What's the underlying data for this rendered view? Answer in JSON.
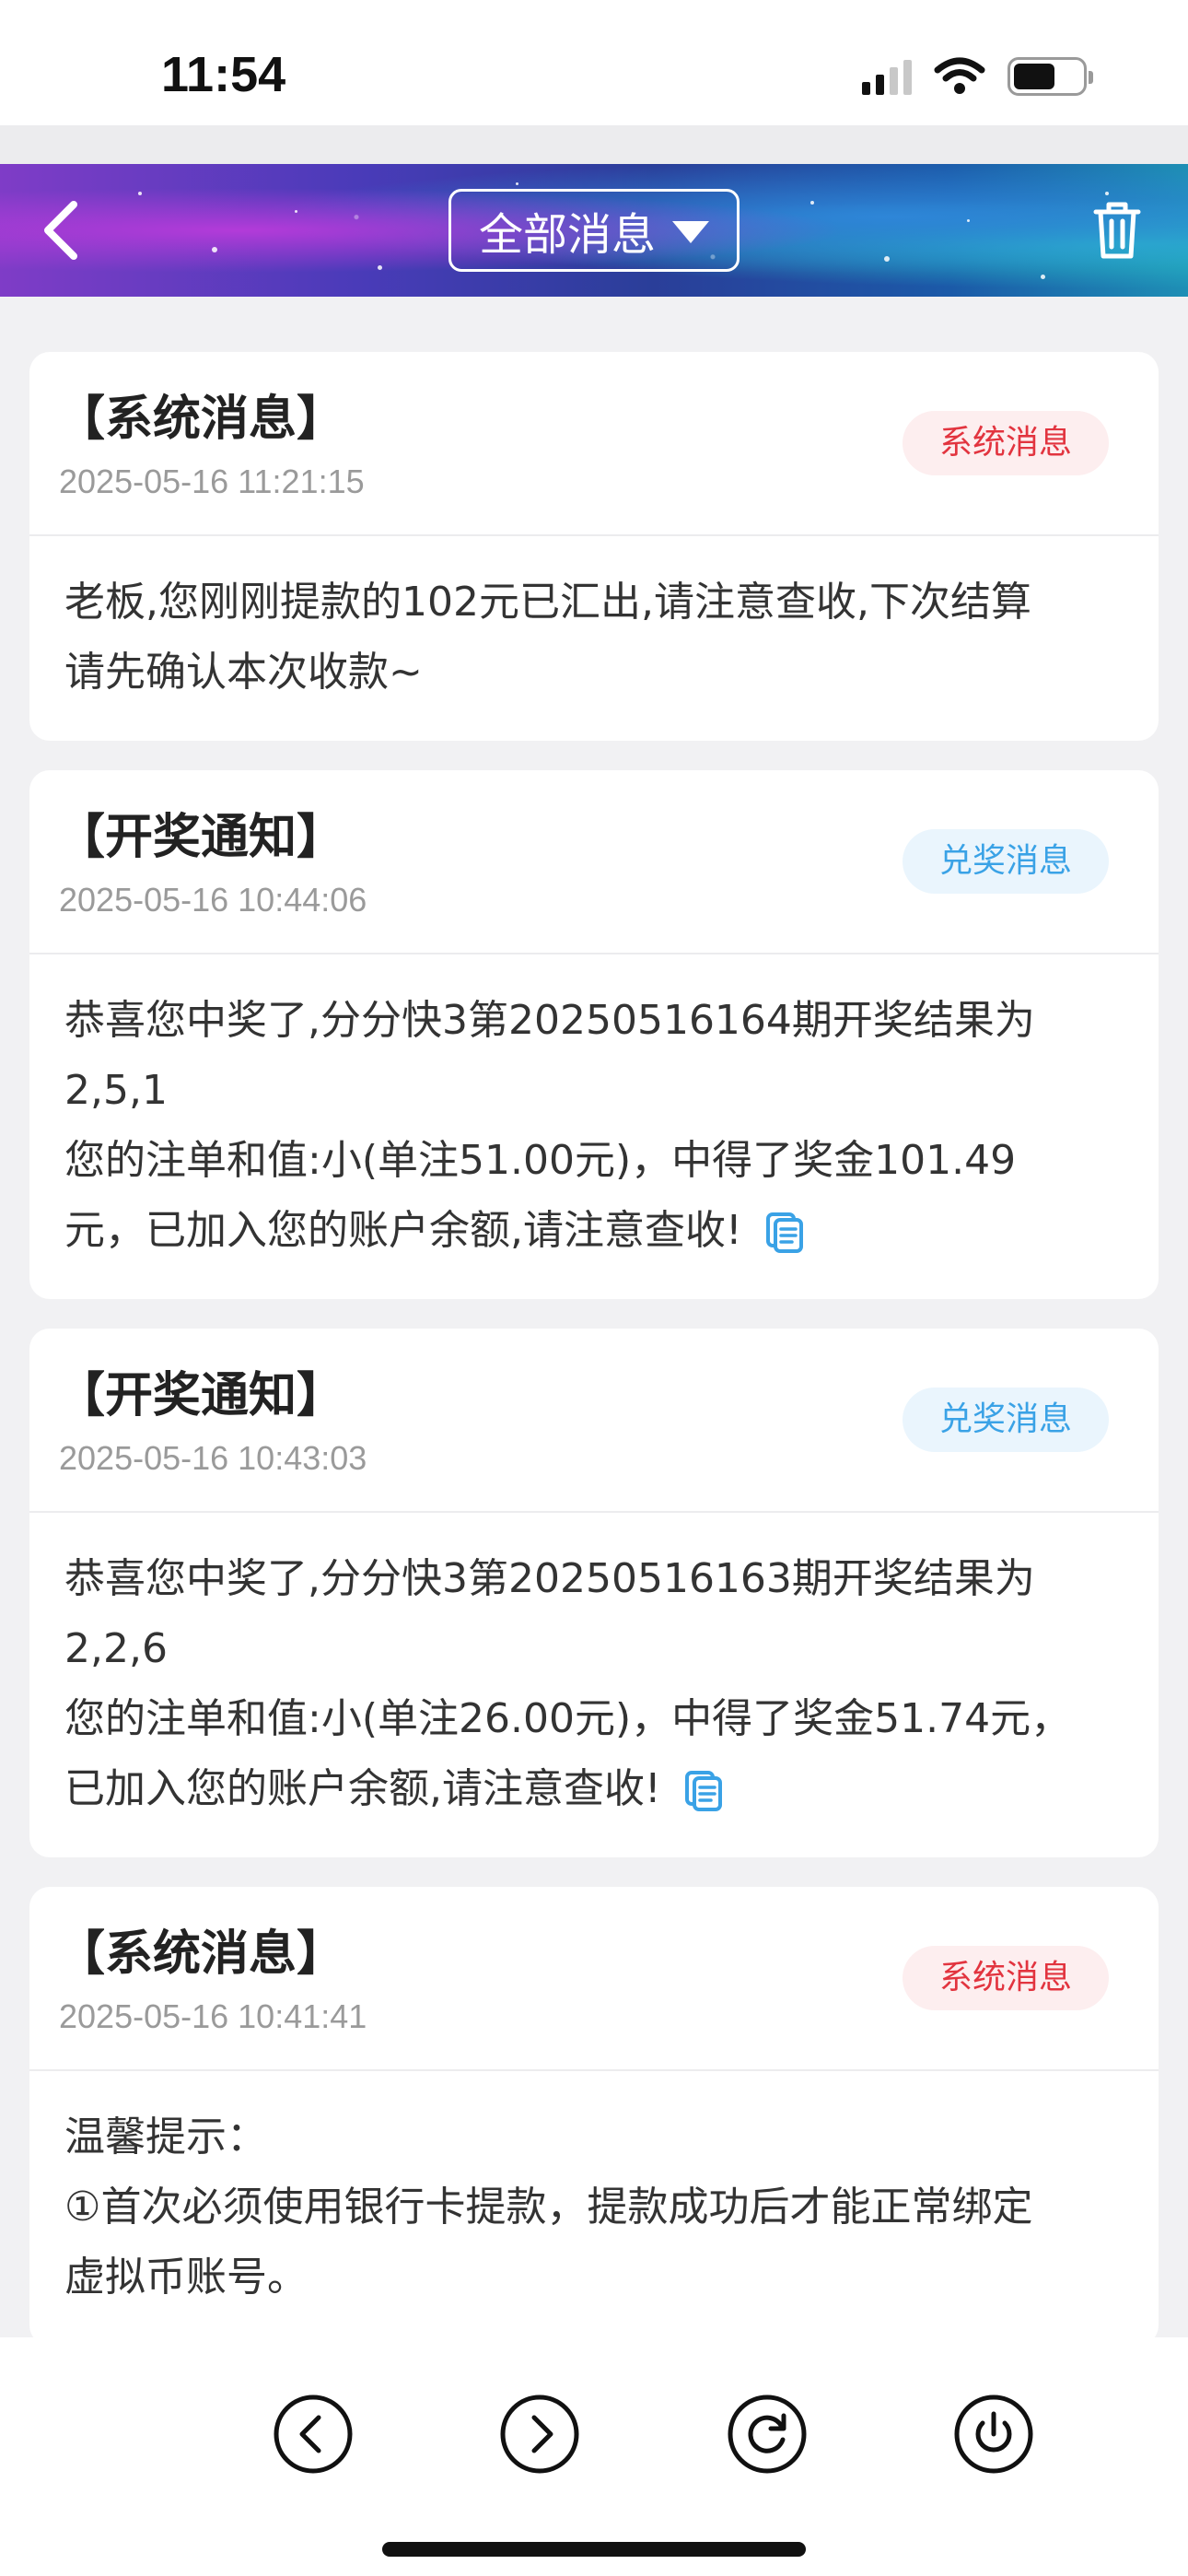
{
  "status_bar": {
    "time": "11:54"
  },
  "nav": {
    "title": "全部消息",
    "icons": {
      "back": "chevron-left-icon",
      "dropdown": "caret-down-icon",
      "delete": "trash-icon"
    }
  },
  "messages": [
    {
      "title": "【系统消息】",
      "date": "2025-05-16 11:21:15",
      "badge": "系统消息",
      "badge_type": "system",
      "body": [
        "老板,您刚刚提款的102元已汇出,请注意查收,下次结算",
        "请先确认本次收款~"
      ]
    },
    {
      "title": "【开奖通知】",
      "date": "2025-05-16 10:44:06",
      "badge": "兑奖消息",
      "badge_type": "prize",
      "body": [
        "恭喜您中奖了,分分快3第20250516164期开奖结果为",
        "2,5,1",
        "您的注单和值:小(单注51.00元)，中得了奖金101.49",
        "元，已加入您的账户余额,请注意查收!"
      ]
    },
    {
      "title": "【开奖通知】",
      "date": "2025-05-16 10:43:03",
      "badge": "兑奖消息",
      "badge_type": "prize",
      "body": [
        "恭喜您中奖了,分分快3第20250516163期开奖结果为",
        "2,2,6",
        "您的注单和值:小(单注26.00元)，中得了奖金51.74元，",
        "已加入您的账户余额,请注意查收!"
      ]
    },
    {
      "title": "【系统消息】",
      "date": "2025-05-16 10:41:41",
      "badge": "系统消息",
      "badge_type": "system",
      "body": [
        "温馨提示：",
        "①首次必须使用银行卡提款，提款成功后才能正常绑定",
        "虚拟币账号。"
      ]
    }
  ],
  "bottom_bar": {
    "icons": [
      "back-circle-icon",
      "forward-circle-icon",
      "refresh-icon",
      "power-icon"
    ]
  },
  "colors": {
    "system_badge": "#e2343f",
    "prize_badge": "#3aa2e6",
    "copy_icon": "#3aa2e6"
  }
}
